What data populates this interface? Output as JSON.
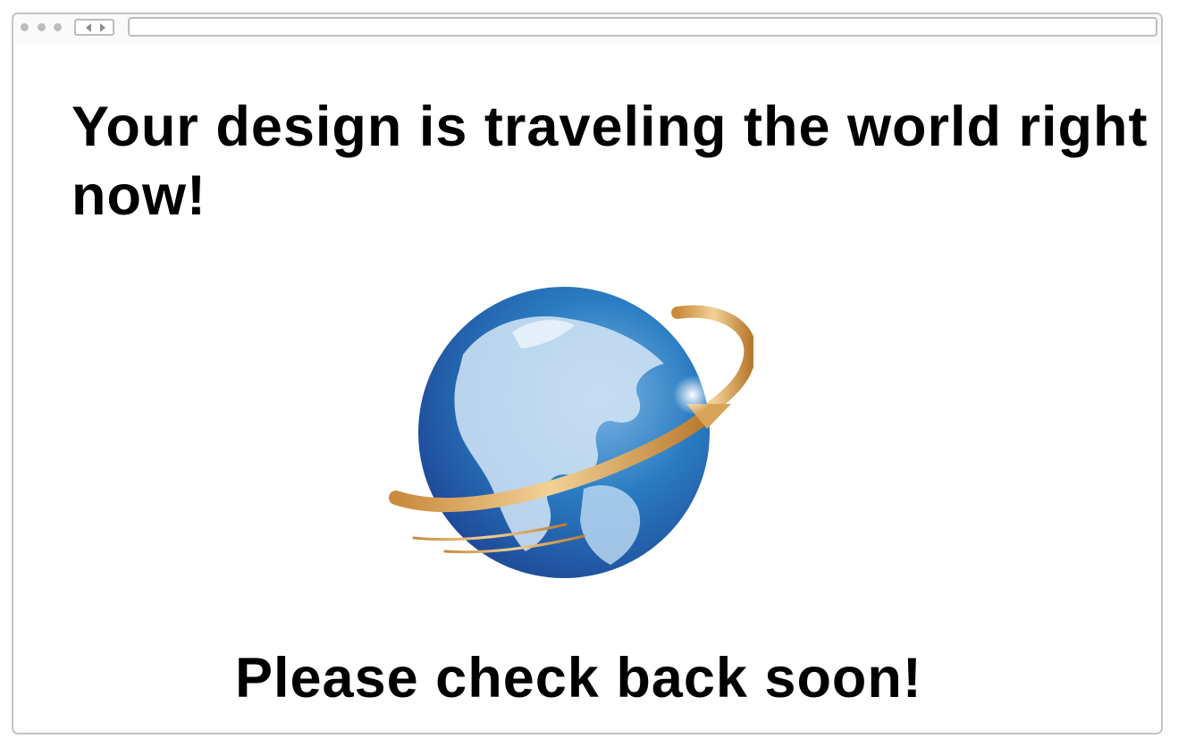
{
  "headline": "Your design is traveling the world right now!",
  "subline": "Please check back soon!",
  "illustration": "globe-with-orbit-arrow",
  "colors": {
    "text": "#000000",
    "globe_ocean": "#1f6fb5",
    "globe_land": "#cfe3f5",
    "orbit_gold": "#d9a85a"
  }
}
